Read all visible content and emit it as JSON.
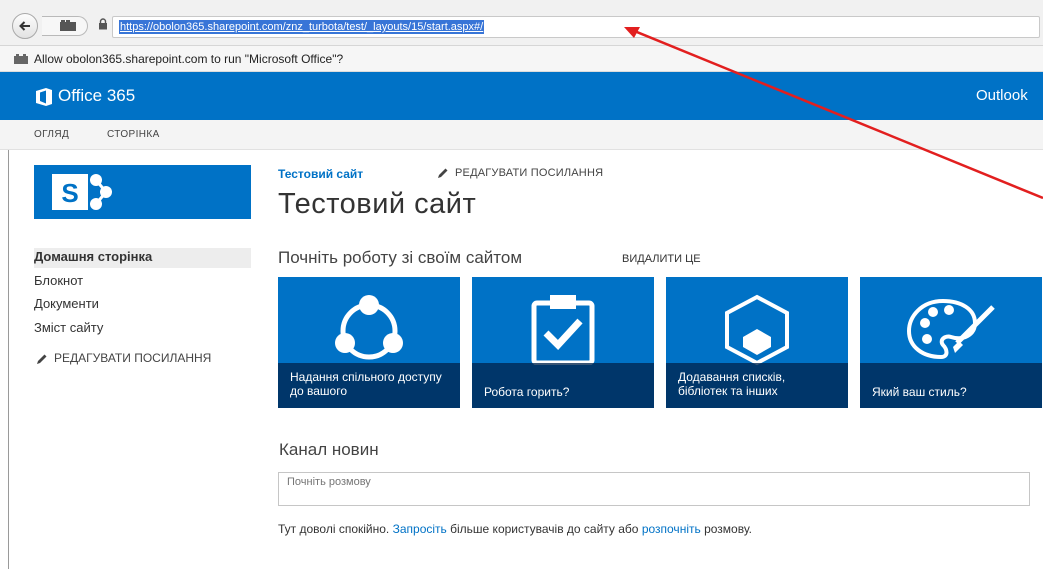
{
  "browser": {
    "url": "https://obolon365.sharepoint.com/znz_turbota/test/_layouts/15/start.aspx#/"
  },
  "notification": {
    "text": "Allow obolon365.sharepoint.com to run \"Microsoft Office\"?"
  },
  "suite": {
    "brand": "Office 365",
    "outlook": "Outlook",
    "brand_color": "#0072c6"
  },
  "ribbon": {
    "tabs": [
      "ОГЛЯД",
      "СТОРІНКА"
    ]
  },
  "left_nav": {
    "items": [
      "Домашня сторінка",
      "Блокнот",
      "Документи",
      "Зміст сайту"
    ],
    "edit_links": "РЕДАГУВАТИ ПОСИЛАННЯ"
  },
  "main": {
    "breadcrumb_site": "Тестовий сайт",
    "edit_links": "РЕДАГУВАТИ ПОСИЛАННЯ",
    "title": "Тестовий сайт",
    "getting_started": "Почніть роботу зі своїм сайтом",
    "remove": "ВИДАЛИТИ ЦЕ",
    "tiles": [
      {
        "caption": "Надання спільного доступу до вашого",
        "icon": "share-icon"
      },
      {
        "caption": "Робота горить?",
        "icon": "clipboard-check-icon"
      },
      {
        "caption": "Додавання списків, бібліотек та інших",
        "icon": "add-app-icon"
      },
      {
        "caption": "Який ваш стиль?",
        "icon": "palette-icon"
      }
    ],
    "newsfeed_title": "Канал новин",
    "post_placeholder": "Почніть розмову",
    "quiet": {
      "prefix": "Тут доволі спокійно.",
      "invite": "Запросіть",
      "middle": "більше користувачів до сайту або",
      "start": "розпочніть",
      "suffix": "розмову."
    }
  }
}
